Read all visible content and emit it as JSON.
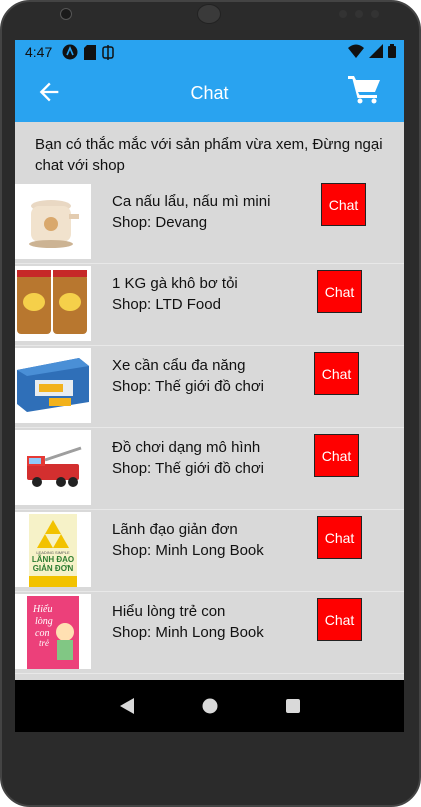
{
  "status": {
    "time": "4:47"
  },
  "appbar": {
    "title": "Chat",
    "back_icon": "arrow-left-icon",
    "cart_icon": "cart-icon"
  },
  "intro": "Bạn có thắc mắc với sản phẩm vừa xem, Đừng ngại chat với shop",
  "products": [
    {
      "name": "Ca nấu lẩu, nấu mì mini",
      "shop": "Shop: Devang",
      "chat": "Chat"
    },
    {
      "name": "1 KG gà khô bơ tỏi",
      "shop": "Shop: LTD Food",
      "chat": "Chat"
    },
    {
      "name": "Xe cần cẩu đa năng",
      "shop": "Shop: Thế giới đồ chơi",
      "chat": "Chat"
    },
    {
      "name": "Đồ chơi dạng mô hình",
      "shop": "Shop: Thế giới đồ chơi",
      "chat": "Chat"
    },
    {
      "name": "Lãnh đạo giản đơn",
      "shop": "Shop: Minh Long Book",
      "chat": "Chat"
    },
    {
      "name": "Hiểu lòng trẻ con",
      "shop": "Shop: Minh Long Book",
      "chat": "Chat"
    }
  ],
  "book_cover_lettering": {
    "leader_book": [
      "LEADING SIMPLE",
      "LÃNH ĐẠO",
      "GIẢN ĐƠN"
    ],
    "kid_book": [
      "Hiểu",
      "lòng",
      "con",
      "trẻ"
    ]
  },
  "colors": {
    "accent": "#29a3f0",
    "chat_button": "#ff0000",
    "background": "#d9d9d9"
  }
}
